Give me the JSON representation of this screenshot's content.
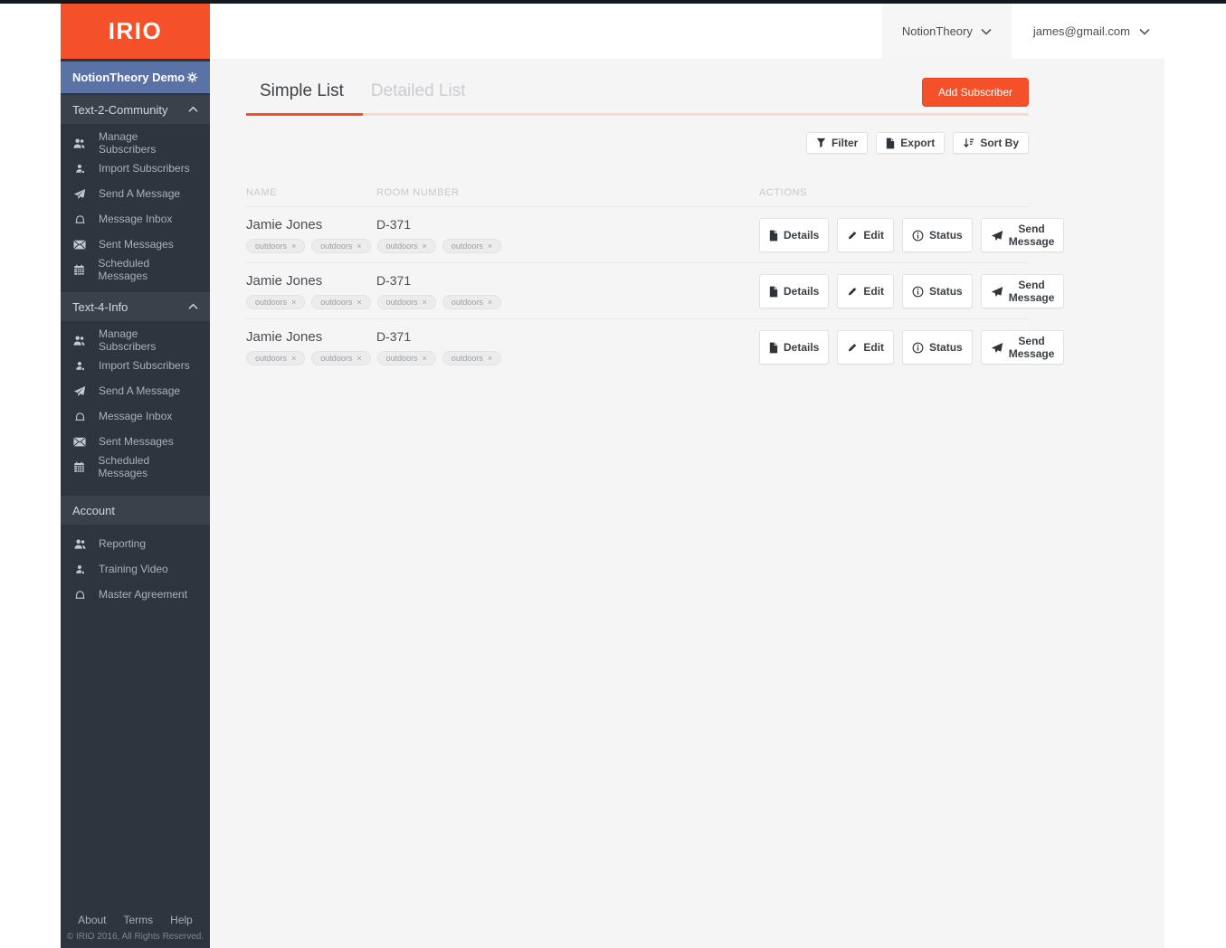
{
  "brand": {
    "logo": "IRIO"
  },
  "header": {
    "org": {
      "label": "NotionTheory"
    },
    "account": {
      "label": "james@gmail.com"
    }
  },
  "sidebar": {
    "workspace": {
      "label": "NotionTheory Demo",
      "icon": "gear-icon"
    },
    "sections": [
      {
        "label": "Text-2-Community",
        "collapsible": true,
        "items": [
          {
            "icon": "users-icon",
            "label": "Manage Subscribers"
          },
          {
            "icon": "user-plus-icon",
            "label": "Import Subscribers"
          },
          {
            "icon": "paper-plane-icon",
            "label": "Send A Message"
          },
          {
            "icon": "inbox-icon",
            "label": "Message Inbox"
          },
          {
            "icon": "envelope-icon",
            "label": "Sent Messages"
          },
          {
            "icon": "calendar-icon",
            "label": "Scheduled Messages"
          }
        ]
      },
      {
        "label": "Text-4-Info",
        "collapsible": true,
        "items": [
          {
            "icon": "users-icon",
            "label": "Manage Subscribers"
          },
          {
            "icon": "user-plus-icon",
            "label": "Import Subscribers"
          },
          {
            "icon": "paper-plane-icon",
            "label": "Send A Message"
          },
          {
            "icon": "inbox-icon",
            "label": "Message Inbox"
          },
          {
            "icon": "envelope-icon",
            "label": "Sent Messages"
          },
          {
            "icon": "calendar-icon",
            "label": "Scheduled Messages"
          }
        ]
      },
      {
        "label": "Account",
        "collapsible": false,
        "items": [
          {
            "icon": "users-icon",
            "label": "Reporting"
          },
          {
            "icon": "user-plus-icon",
            "label": "Training Video"
          },
          {
            "icon": "inbox-icon",
            "label": "Master Agreement"
          }
        ]
      }
    ],
    "footer": {
      "links": [
        "About",
        "Terms",
        "Help"
      ],
      "copyright": "© IRIO 2016, All Rights Reserved."
    }
  },
  "main": {
    "tabs": [
      {
        "label": "Simple List",
        "active": true
      },
      {
        "label": "Detailed List",
        "active": false
      }
    ],
    "add_subscriber_label": "Add Subscriber",
    "toolbar": [
      {
        "icon": "filter-icon",
        "label": "Filter"
      },
      {
        "icon": "export-file-icon",
        "label": "Export"
      },
      {
        "icon": "sort-icon",
        "label": "Sort By"
      }
    ],
    "table": {
      "columns": [
        "NAME",
        "ROOM NUMBER",
        "ACTIONS"
      ],
      "tag_remove": "×",
      "row_actions": [
        "Details",
        "Edit",
        "Status",
        "Send Message"
      ],
      "rows": [
        {
          "name": "Jamie Jones",
          "room": "D-371",
          "tags": [
            "outdoors",
            "outdoors",
            "outdoors",
            "outdoors"
          ]
        },
        {
          "name": "Jamie Jones",
          "room": "D-371",
          "tags": [
            "outdoors",
            "outdoors",
            "outdoors",
            "outdoors"
          ]
        },
        {
          "name": "Jamie Jones",
          "room": "D-371",
          "tags": [
            "outdoors",
            "outdoors",
            "outdoors",
            "outdoors"
          ]
        }
      ]
    }
  },
  "colors": {
    "accent_orange": "#f4502a",
    "pale_underline": "#f9dad1",
    "sidebar_bg": "#2f353e",
    "sidebar_section_bg": "#3a414b",
    "workspace_blue": "#5b73a4",
    "main_bg": "#f5f5f6",
    "header_bg": "#ffffff"
  }
}
